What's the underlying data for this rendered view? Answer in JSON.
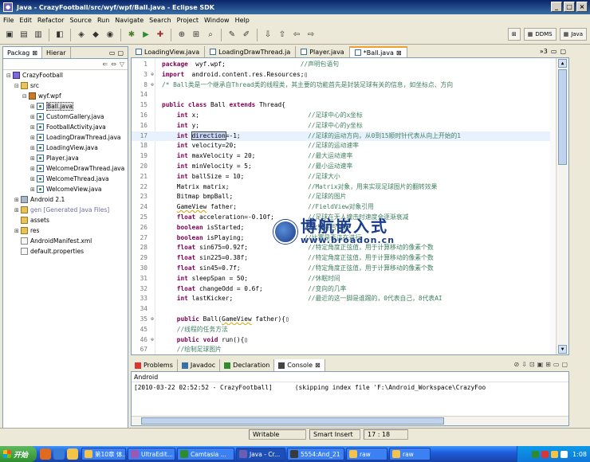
{
  "window": {
    "title": "Java - CrazyFootball/src/wyf/wpf/Ball.java - Eclipse SDK"
  },
  "menu": [
    "File",
    "Edit",
    "Refactor",
    "Source",
    "Run",
    "Navigate",
    "Search",
    "Project",
    "Window",
    "Help"
  ],
  "perspectives": [
    "DDMS",
    "Java"
  ],
  "left_panel": {
    "tabs": [
      "Packag",
      "Hierar"
    ],
    "tree": [
      {
        "indent": 0,
        "exp": "⊟",
        "icon": "proj",
        "label": "CrazyFootball"
      },
      {
        "indent": 1,
        "exp": "⊟",
        "icon": "folder",
        "label": "src"
      },
      {
        "indent": 2,
        "exp": "⊟",
        "icon": "pkg",
        "label": "wyf.wpf"
      },
      {
        "indent": 3,
        "exp": "⊞",
        "icon": "java",
        "label": "Ball.java",
        "selected": true
      },
      {
        "indent": 3,
        "exp": "⊞",
        "icon": "java",
        "label": "CustomGallery.java"
      },
      {
        "indent": 3,
        "exp": "⊞",
        "icon": "java",
        "label": "FootballActivity.java"
      },
      {
        "indent": 3,
        "exp": "⊞",
        "icon": "java",
        "label": "LoadingDrawThread.java"
      },
      {
        "indent": 3,
        "exp": "⊞",
        "icon": "java",
        "label": "LoadingView.java"
      },
      {
        "indent": 3,
        "exp": "⊞",
        "icon": "java",
        "label": "Player.java"
      },
      {
        "indent": 3,
        "exp": "⊞",
        "icon": "java",
        "label": "WelcomeDrawThread.java"
      },
      {
        "indent": 3,
        "exp": "⊞",
        "icon": "java",
        "label": "WelcomeThread.java"
      },
      {
        "indent": 3,
        "exp": "⊞",
        "icon": "java",
        "label": "WelcomeView.java"
      },
      {
        "indent": 1,
        "exp": "⊞",
        "icon": "lib",
        "label": "Android 2.1"
      },
      {
        "indent": 1,
        "exp": "⊞",
        "icon": "folder",
        "label": "gen [Generated Java Files]",
        "gen": true
      },
      {
        "indent": 1,
        "exp": "",
        "icon": "folder",
        "label": "assets"
      },
      {
        "indent": 1,
        "exp": "⊞",
        "icon": "folder",
        "label": "res"
      },
      {
        "indent": 1,
        "exp": "",
        "icon": "file",
        "label": "AndroidManifest.xml"
      },
      {
        "indent": 1,
        "exp": "",
        "icon": "file",
        "label": "default.properties"
      }
    ]
  },
  "editor": {
    "tabs": [
      {
        "label": "LoadingView.java",
        "active": false
      },
      {
        "label": "LoadingDrawThread.ja",
        "active": false
      },
      {
        "label": "Player.java",
        "active": false
      },
      {
        "label": "*Ball.java",
        "active": true
      }
    ],
    "overflow": "»3",
    "lines": [
      {
        "n": "1",
        "mk": "",
        "segs": [
          [
            "kw",
            "package"
          ],
          [
            "",
            "  wyf.wpf;                    "
          ],
          [
            "cm",
            "//声明包语句"
          ]
        ]
      },
      {
        "n": "3",
        "mk": "⊕",
        "segs": [
          [
            "kw",
            "import"
          ],
          [
            "",
            "  android.content.res.Resources;"
          ],
          [
            "",
            "▯"
          ]
        ]
      },
      {
        "n": "8",
        "mk": "⊕",
        "segs": [
          [
            "cm",
            "/* Ball类是一个继承自Thread类的线程类，其主要的功能首先是封装足球有关的信息，如坐标点、方向"
          ]
        ]
      },
      {
        "n": "14",
        "mk": "",
        "segs": []
      },
      {
        "n": "15",
        "mk": "",
        "segs": [
          [
            "kw",
            "public class "
          ],
          [
            "",
            "Ball "
          ],
          [
            "kw",
            "extends "
          ],
          [
            "",
            "Thread{"
          ]
        ]
      },
      {
        "n": "16",
        "mk": "",
        "segs": [
          [
            "",
            "    "
          ],
          [
            "kw",
            "int "
          ],
          [
            "",
            "x;                             "
          ],
          [
            "cm",
            "//足球中心的x坐标"
          ]
        ]
      },
      {
        "n": "16",
        "mk": "",
        "segs": [
          [
            "",
            "    "
          ],
          [
            "kw",
            "int "
          ],
          [
            "",
            "y;                             "
          ],
          [
            "cm",
            "//足球中心的y坐标"
          ]
        ]
      },
      {
        "n": "17",
        "mk": "",
        "cur": true,
        "segs": [
          [
            "",
            "    "
          ],
          [
            "kw",
            "int "
          ],
          [
            "hl",
            "direction"
          ],
          [
            "",
            "=-1;                  "
          ],
          [
            "cm",
            "//足球的运动方向，从0到15顺时针代表从向上开始的1"
          ]
        ]
      },
      {
        "n": "18",
        "mk": "",
        "segs": [
          [
            "",
            "    "
          ],
          [
            "kw",
            "int "
          ],
          [
            "",
            "velocity=20;                   "
          ],
          [
            "cm",
            "//足球的运动速率"
          ]
        ]
      },
      {
        "n": "19",
        "mk": "",
        "segs": [
          [
            "",
            "    "
          ],
          [
            "kw",
            "int "
          ],
          [
            "",
            "maxVelocity = 20;              "
          ],
          [
            "cm",
            "//最大运动速率"
          ]
        ]
      },
      {
        "n": "20",
        "mk": "",
        "segs": [
          [
            "",
            "    "
          ],
          [
            "kw",
            "int "
          ],
          [
            "",
            "minVelocity = 5;               "
          ],
          [
            "cm",
            "//最小运动速率"
          ]
        ]
      },
      {
        "n": "21",
        "mk": "",
        "segs": [
          [
            "",
            "    "
          ],
          [
            "kw",
            "int "
          ],
          [
            "",
            "ballSize = 10;                 "
          ],
          [
            "cm",
            "//足球大小"
          ]
        ]
      },
      {
        "n": "22",
        "mk": "",
        "segs": [
          [
            "",
            "    Matrix matrix;                     "
          ],
          [
            "cm",
            "//Matrix对象，用来实现足球图片的翻转效果"
          ]
        ]
      },
      {
        "n": "23",
        "mk": "",
        "segs": [
          [
            "",
            "    Bitmap bmpBall;                    "
          ],
          [
            "cm",
            "//足球的图片"
          ]
        ]
      },
      {
        "n": "24",
        "mk": "",
        "segs": [
          [
            "",
            "    "
          ],
          [
            "warn",
            "GameView"
          ],
          [
            "",
            " father;                   "
          ],
          [
            "cm",
            "//FieldView对象引用"
          ]
        ]
      },
      {
        "n": "25",
        "mk": "",
        "segs": [
          [
            "",
            "    "
          ],
          [
            "kw",
            "float "
          ],
          [
            "",
            "acceleration=-0.10f;         "
          ],
          [
            "cm",
            "//足球在无人撞击时速度会逐渐衰减"
          ]
        ]
      },
      {
        "n": "26",
        "mk": "",
        "segs": [
          [
            "",
            "    "
          ],
          [
            "kw",
            "boolean "
          ],
          [
            "",
            "isStarted;                "
          ],
          [
            "cm",
            "//比赛是否开始"
          ]
        ]
      },
      {
        "n": "27",
        "mk": "",
        "segs": [
          [
            "",
            "    "
          ],
          [
            "kw",
            "boolean "
          ],
          [
            "",
            "isPlaying;                "
          ],
          [
            "cm",
            "//比赛是否正在进行"
          ]
        ]
      },
      {
        "n": "28",
        "mk": "",
        "segs": [
          [
            "",
            "    "
          ],
          [
            "kw",
            "float "
          ],
          [
            "",
            "sin675=0.92f;                "
          ],
          [
            "cm",
            "//特定角度正弦值，用于计算移动的像素个数"
          ]
        ]
      },
      {
        "n": "29",
        "mk": "",
        "segs": [
          [
            "",
            "    "
          ],
          [
            "kw",
            "float "
          ],
          [
            "",
            "sin225=0.38f;                "
          ],
          [
            "cm",
            "//特定角度正弦值，用于计算移动的像素个数"
          ]
        ]
      },
      {
        "n": "30",
        "mk": "",
        "segs": [
          [
            "",
            "    "
          ],
          [
            "kw",
            "float "
          ],
          [
            "",
            "sin45=0.7f;                  "
          ],
          [
            "cm",
            "//特定角度正弦值，用于计算移动的像素个数"
          ]
        ]
      },
      {
        "n": "31",
        "mk": "",
        "segs": [
          [
            "",
            "    "
          ],
          [
            "kw",
            "int "
          ],
          [
            "",
            "sleepSpan = 50;                "
          ],
          [
            "cm",
            "//休眠时间"
          ]
        ]
      },
      {
        "n": "32",
        "mk": "",
        "segs": [
          [
            "",
            "    "
          ],
          [
            "kw",
            "float "
          ],
          [
            "",
            "changeOdd = 0.6f;            "
          ],
          [
            "cm",
            "//变向的几率"
          ]
        ]
      },
      {
        "n": "33",
        "mk": "",
        "segs": [
          [
            "",
            "    "
          ],
          [
            "kw",
            "int "
          ],
          [
            "",
            "lastKicker;                    "
          ],
          [
            "cm",
            "//最近的这一脚是谁踢的，0代表自己，8代表AI"
          ]
        ]
      },
      {
        "n": "34",
        "mk": "",
        "segs": []
      },
      {
        "n": "35",
        "mk": "⊕",
        "segs": [
          [
            "",
            "    "
          ],
          [
            "kw",
            "public "
          ],
          [
            "",
            "Ball("
          ],
          [
            "warn",
            "GameView"
          ],
          [
            "",
            " father){"
          ],
          [
            "",
            "▯"
          ]
        ]
      },
      {
        "n": "45",
        "mk": "",
        "segs": [
          [
            "",
            "    "
          ],
          [
            "cm",
            "//线程的任务方法"
          ]
        ]
      },
      {
        "n": "46",
        "mk": "⊕",
        "segs": [
          [
            "",
            "    "
          ],
          [
            "kw",
            "public void "
          ],
          [
            "",
            "run(){"
          ],
          [
            "",
            "▯"
          ]
        ]
      },
      {
        "n": "67",
        "mk": "",
        "segs": [
          [
            "",
            "    "
          ],
          [
            "cm",
            "//绘制足球图片"
          ]
        ]
      },
      {
        "n": "68",
        "mk": "⊕",
        "segs": [
          [
            "",
            "    "
          ],
          [
            "kw",
            "public void "
          ],
          [
            "",
            "drawSelf(Canvas canvas){"
          ]
        ]
      }
    ]
  },
  "watermark": {
    "cn": "博航嵌入式",
    "url": "www.broadon.cn"
  },
  "bottom_panel": {
    "tabs": [
      {
        "label": "Problems",
        "active": false
      },
      {
        "label": "Javadoc",
        "active": false
      },
      {
        "label": "Declaration",
        "active": false
      },
      {
        "label": "Console",
        "active": true
      }
    ],
    "console_title": "Android",
    "console_line": "[2010-03-22 02:52:52 - CrazyFootball]      (skipping index file 'F:\\Android_Workspace\\CrazyFoo"
  },
  "status": {
    "writable": "Writable",
    "insert": "Smart Insert",
    "position": "17 : 18"
  },
  "taskbar": {
    "start": "开始",
    "tasks": [
      "第10章 体...",
      "UltraEdit...",
      "Camtasia ...",
      "Java - Cr...",
      "5554:And_21",
      "raw",
      "raw"
    ],
    "active_index": 3,
    "clock": "1:08"
  },
  "colors": {
    "keyword": "#7f0055",
    "comment": "#3f7f5f",
    "title_bar": "#0a246a",
    "taskbar": "#1e5ede"
  }
}
